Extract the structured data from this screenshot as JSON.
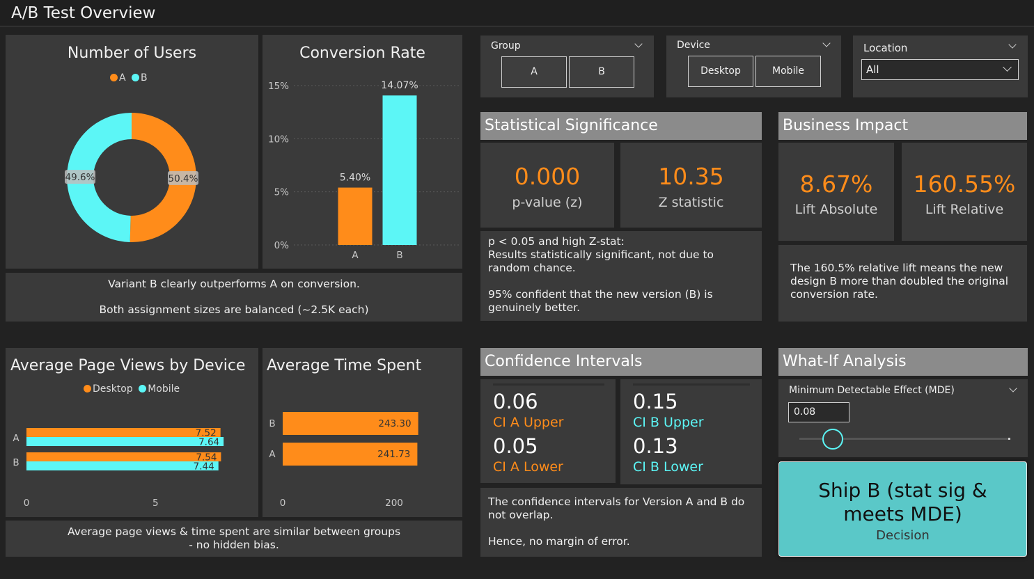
{
  "app": {
    "title": "A/B Test Overview"
  },
  "colors": {
    "a": "#ff8c1a",
    "b": "#5cf6f6",
    "panel": "#3a3a3a",
    "header": "#8b8b8b",
    "decision_bg": "#5ac8c8"
  },
  "users_chart": {
    "title": "Number of Users",
    "legend": [
      "A",
      "B"
    ],
    "chart_data": {
      "type": "pie",
      "donut": true,
      "categories": [
        "A",
        "B"
      ],
      "values": [
        50.4,
        49.6
      ],
      "labels": [
        "50.4%",
        "49.6%"
      ]
    }
  },
  "conversion_chart": {
    "title": "Conversion Rate",
    "chart_data": {
      "type": "bar",
      "categories": [
        "A",
        "B"
      ],
      "values": [
        5.4,
        14.07
      ],
      "labels": [
        "5.40%",
        "14.07%"
      ],
      "ylim": [
        0,
        15
      ],
      "yticks": [
        "0%",
        "5%",
        "10%",
        "15%"
      ],
      "grid": true
    }
  },
  "users_note": {
    "line1": "Variant B clearly outperforms A on conversion.",
    "line2": "Both assignment sizes are balanced (~2.5K each)"
  },
  "slicers": {
    "group": {
      "label": "Group",
      "options": [
        "A",
        "B"
      ]
    },
    "device": {
      "label": "Device",
      "options": [
        "Desktop",
        "Mobile"
      ]
    },
    "location": {
      "label": "Location",
      "value": "All"
    }
  },
  "stat_sig": {
    "header": "Statistical Significance",
    "pvalue": {
      "value": "0.000",
      "label": "p-value (z)"
    },
    "zstat": {
      "value": "10.35",
      "label": "Z statistic"
    },
    "note": "p < 0.05 and high Z-stat:\nResults statistically significant, not due to random chance.\n\n95% confident that the new version (B) is genuinely better."
  },
  "business": {
    "header": "Business Impact",
    "lift_abs": {
      "value": "8.67%",
      "label": "Lift Absolute"
    },
    "lift_rel": {
      "value": "160.55%",
      "label": "Lift Relative"
    },
    "note": "The 160.5% relative lift means the new design B more than doubled the original conversion rate."
  },
  "pageviews_chart": {
    "title": "Average Page Views by Device",
    "legend": [
      "Desktop",
      "Mobile"
    ],
    "chart_data": {
      "type": "bar",
      "orientation": "horizontal",
      "categories": [
        "A",
        "B"
      ],
      "series": [
        {
          "name": "Desktop",
          "values": [
            7.52,
            7.54
          ]
        },
        {
          "name": "Mobile",
          "values": [
            7.64,
            7.44
          ]
        }
      ],
      "xlim": [
        0,
        8.5
      ],
      "xticks": [
        "0",
        "5"
      ]
    }
  },
  "timespent_chart": {
    "title": "Average Time Spent",
    "chart_data": {
      "type": "bar",
      "orientation": "horizontal",
      "categories": [
        "B",
        "A"
      ],
      "values": [
        243.3,
        241.73
      ],
      "labels": [
        "243.30",
        "241.73"
      ],
      "xlim": [
        0,
        300
      ],
      "xticks": [
        "0",
        "200"
      ]
    }
  },
  "pageviews_note": "Average page views & time spent are similar between groups\n- no hidden bias.",
  "ci": {
    "header": "Confidence Intervals",
    "a_upper": {
      "value": "0.06",
      "label": "CI A Upper"
    },
    "a_lower": {
      "value": "0.05",
      "label": "CI A Lower"
    },
    "b_upper": {
      "value": "0.15",
      "label": "CI B Upper"
    },
    "b_lower": {
      "value": "0.13",
      "label": "CI B Lower"
    },
    "note": "The confidence intervals for Version A and B do not overlap.\n\nHence, no margin of error."
  },
  "whatif": {
    "header": "What-If Analysis",
    "mde_label": "Minimum Detectable Effect (MDE)",
    "mde_value": "0.08",
    "slider_level": 0.16
  },
  "decision": {
    "value": "Ship B (stat sig & meets MDE)",
    "label": "Decision"
  }
}
